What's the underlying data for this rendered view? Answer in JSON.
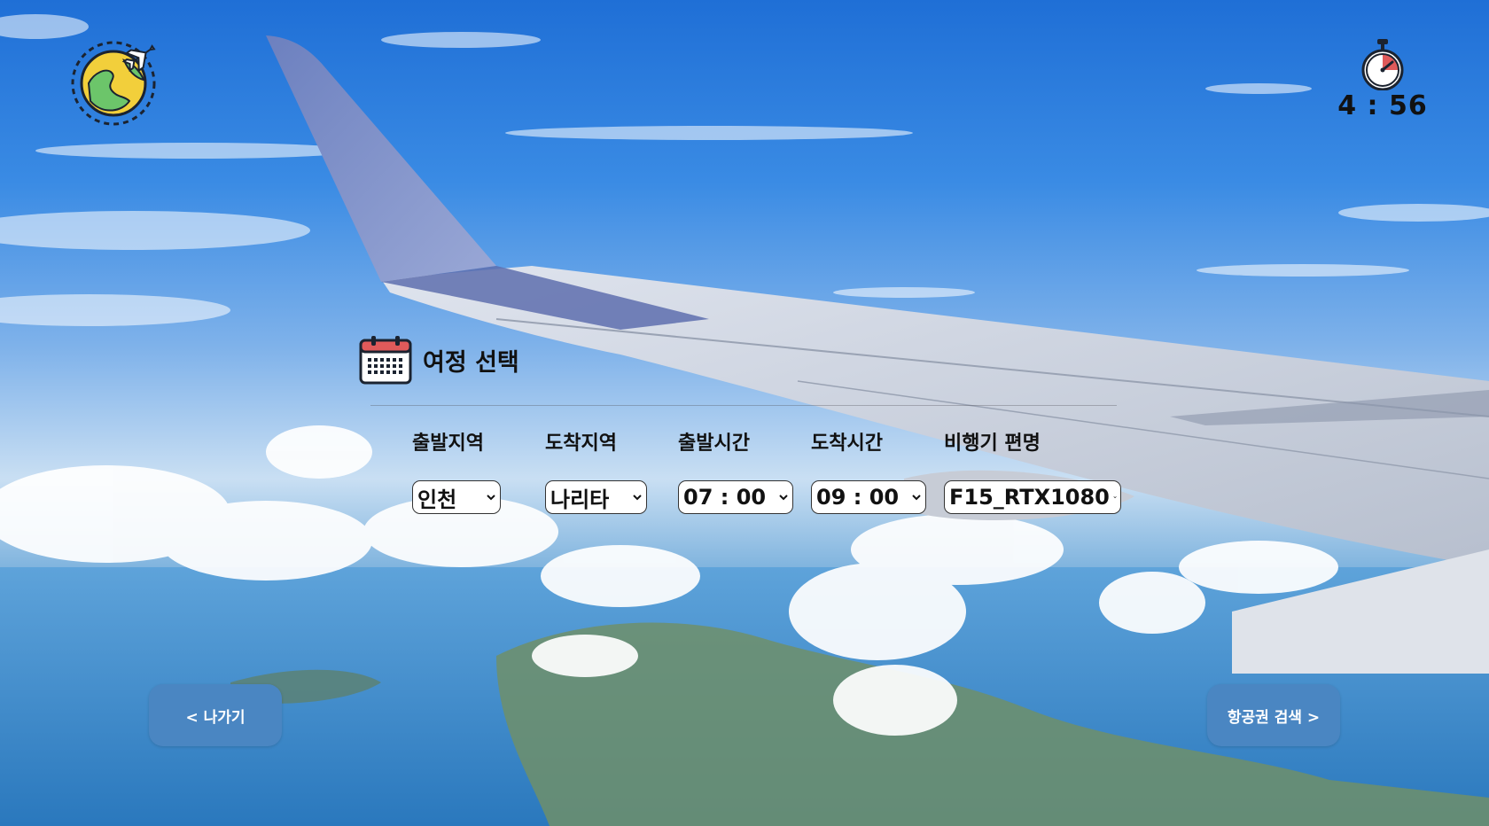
{
  "timer": {
    "text": "4 : 56",
    "icon": "stopwatch-icon"
  },
  "logo": {
    "icon": "globe-airplane-icon"
  },
  "section": {
    "title": "여정 선택",
    "icon": "calendar-icon"
  },
  "fields": [
    {
      "label": "출발지역",
      "value": "인천"
    },
    {
      "label": "도착지역",
      "value": "나리타"
    },
    {
      "label": "출발시간",
      "value": "07 : 00"
    },
    {
      "label": "도착시간",
      "value": "09 : 00"
    },
    {
      "label": "비행기 편명",
      "value": "F15_RTX1080"
    }
  ],
  "buttons": {
    "back": "< 나가기",
    "search": "항공권 검색 >"
  },
  "colors": {
    "button": "#4a86c2",
    "sky": "#2a7ad8",
    "timer_red": "#e05a5a"
  }
}
